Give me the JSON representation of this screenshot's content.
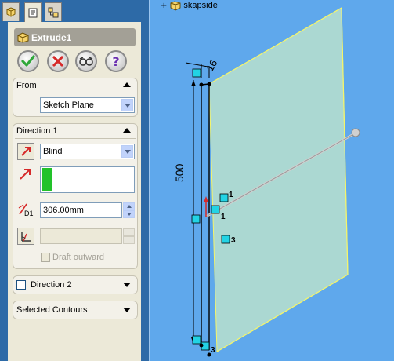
{
  "feature": {
    "title": "Extrude1"
  },
  "confirm": {
    "ok_icon": "checkmark-icon",
    "cancel_icon": "x-icon",
    "preview_icon": "glasses-icon",
    "help_label": "?"
  },
  "from": {
    "header": "From",
    "value": "Sketch Plane"
  },
  "direction1": {
    "header": "Direction 1",
    "end_condition": "Blind",
    "depth": "306.00mm",
    "draft_label": "Draft outward"
  },
  "direction2": {
    "header": "Direction 2"
  },
  "selected_contours": {
    "header": "Selected Contours"
  },
  "tree": {
    "root_label": "skapside",
    "root_toggle": "+"
  },
  "dims": {
    "height": "500",
    "thickness": "16",
    "tag1": "1",
    "tag2": "1",
    "tag3": "3",
    "tag4": "3"
  },
  "colors": {
    "panel_blue": "#2d6aa7",
    "viewport_blue": "#5fa8ec",
    "preview_green": "#c8ead8",
    "edge_yellow": "#f5f56a",
    "handle_cyan": "#22d3e4",
    "ok_green": "#2fa83a",
    "cancel_red": "#d62a2a",
    "help_purple": "#6a2fb0"
  }
}
